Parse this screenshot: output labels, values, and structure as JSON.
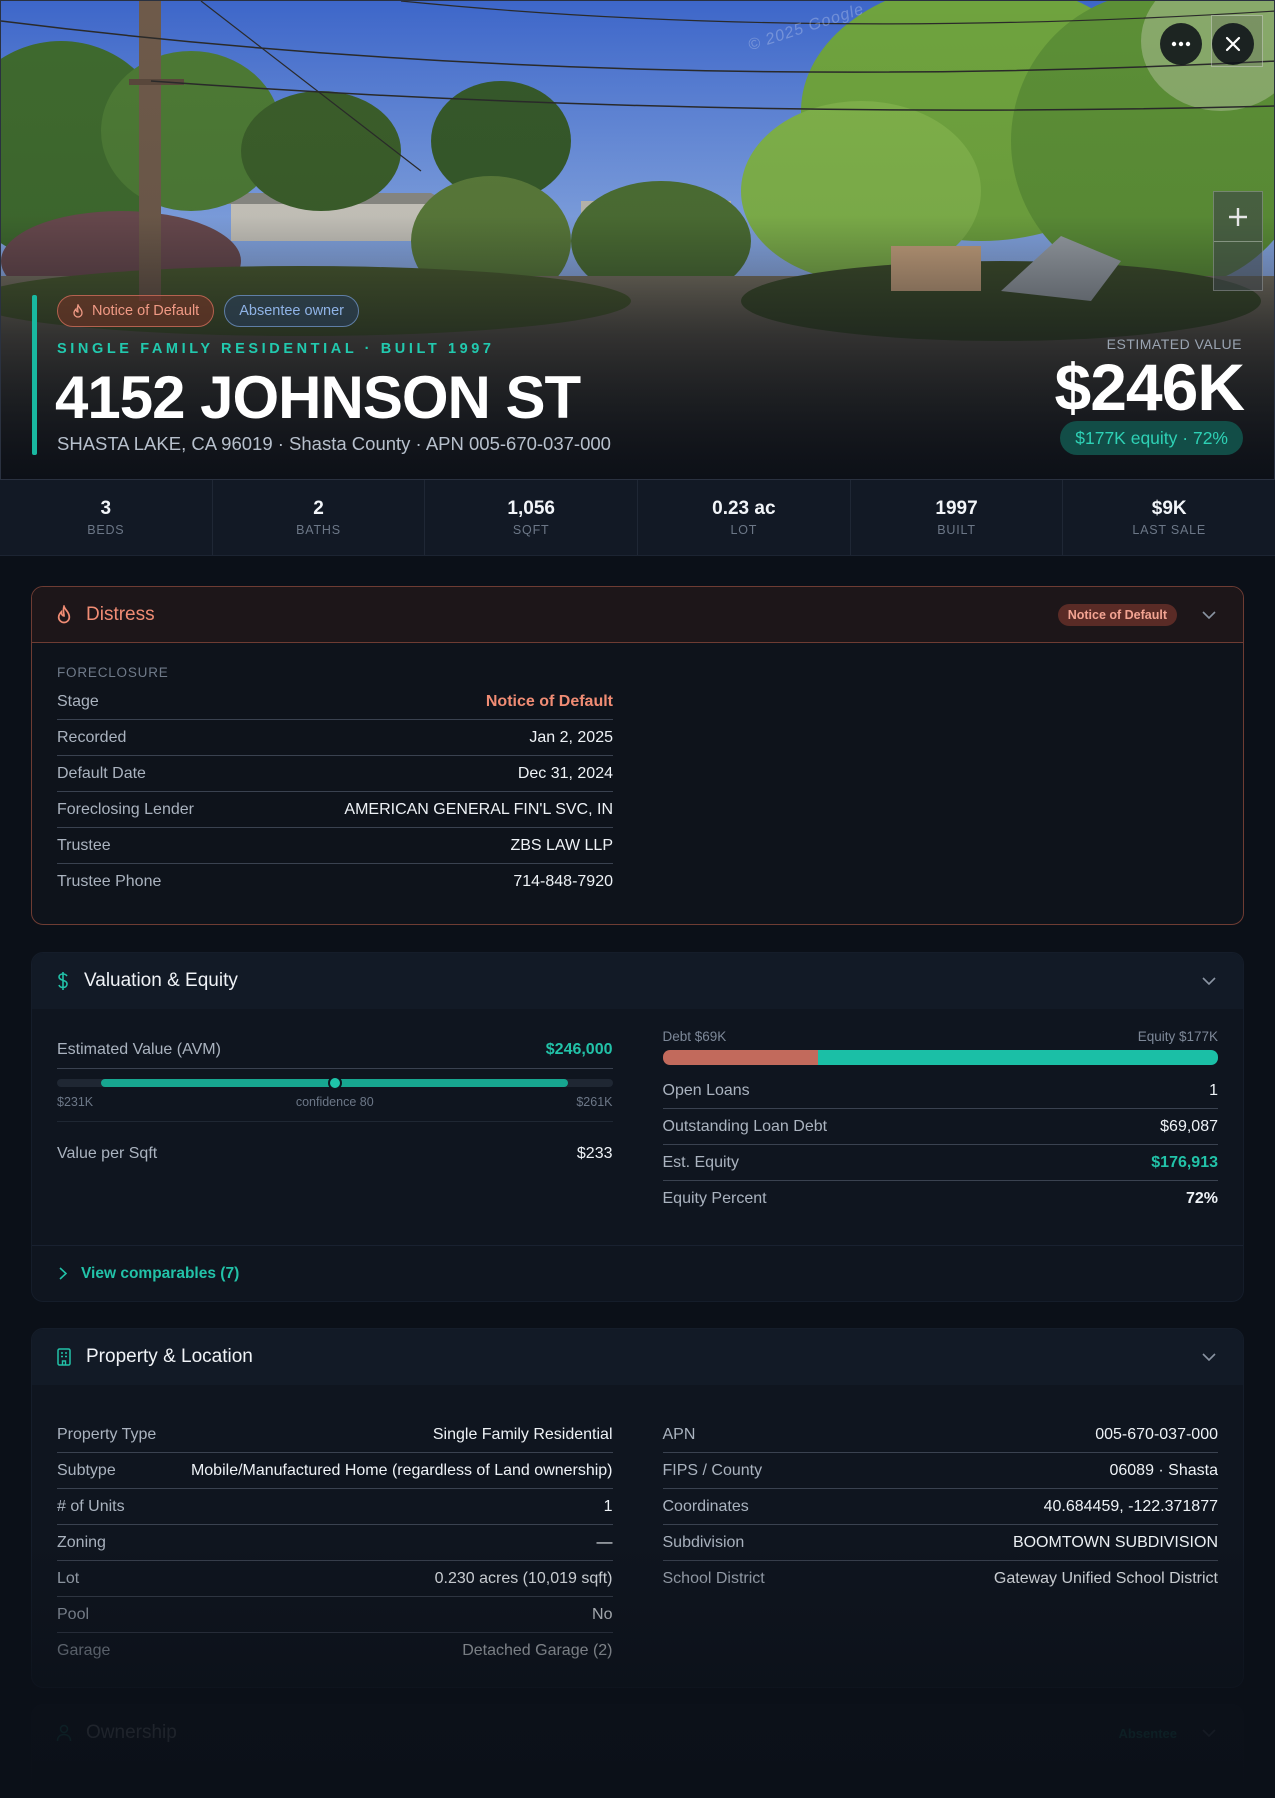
{
  "hero": {
    "watermark": "© 2025 Google",
    "badges": {
      "distress": "Notice of Default",
      "owner": "Absentee owner"
    },
    "property_type": "SINGLE FAMILY RESIDENTIAL · BUILT 1997",
    "address": "4152 JOHNSON ST",
    "sub_address": "SHASTA LAKE, CA 96019 · Shasta County · APN 005-670-037-000",
    "estimated_label": "ESTIMATED VALUE",
    "estimated_value": "$246K",
    "equity_pill": "$177K equity · 72%"
  },
  "stats": [
    {
      "value": "3",
      "label": "BEDS"
    },
    {
      "value": "2",
      "label": "BATHS"
    },
    {
      "value": "1,056",
      "label": "SQFT"
    },
    {
      "value": "0.23 ac",
      "label": "LOT"
    },
    {
      "value": "1997",
      "label": "BUILT"
    },
    {
      "value": "$9K",
      "label": "LAST SALE"
    }
  ],
  "distress": {
    "title": "Distress",
    "badge": "Notice of Default",
    "section": "FORECLOSURE",
    "rows": [
      {
        "k": "Stage",
        "v": "Notice of Default"
      },
      {
        "k": "Recorded",
        "v": "Jan 2, 2025"
      },
      {
        "k": "Default Date",
        "v": "Dec 31, 2024"
      },
      {
        "k": "Foreclosing Lender",
        "v": "AMERICAN GENERAL FIN'L SVC, IN"
      },
      {
        "k": "Trustee",
        "v": "ZBS LAW LLP"
      },
      {
        "k": "Trustee Phone",
        "v": "714-848-7920"
      }
    ]
  },
  "valuation": {
    "title": "Valuation & Equity",
    "avm_label": "Estimated Value (AVM)",
    "avm_value": "$246,000",
    "range_low": "$231K",
    "range_high": "$261K",
    "confidence": "confidence 80",
    "confidence_fraction": 0.5,
    "value_per_sqft_label": "Value per Sqft",
    "value_per_sqft": "$233",
    "debt_label": "Debt $69K",
    "equity_label": "Equity $177K",
    "debt_fraction": 0.28,
    "rows": [
      {
        "k": "Open Loans",
        "v": "1"
      },
      {
        "k": "Outstanding Loan Debt",
        "v": "$69,087"
      },
      {
        "k": "Est. Equity",
        "v": "$176,913"
      },
      {
        "k": "Equity Percent",
        "v": "72%"
      }
    ],
    "comps_label": "View comparables (7)"
  },
  "property": {
    "title": "Property & Location",
    "left": [
      {
        "k": "Property Type",
        "v": "Single Family Residential"
      },
      {
        "k": "Subtype",
        "v": "Mobile/Manufactured Home (regardless of Land ownership)"
      },
      {
        "k": "# of Units",
        "v": "1"
      },
      {
        "k": "Zoning",
        "v": "—"
      },
      {
        "k": "Lot",
        "v": "0.230 acres (10,019 sqft)"
      },
      {
        "k": "Pool",
        "v": "No"
      },
      {
        "k": "Garage",
        "v": "Detached Garage (2)"
      }
    ],
    "right": [
      {
        "k": "APN",
        "v": "005-670-037-000"
      },
      {
        "k": "FIPS / County",
        "v": "06089 · Shasta"
      },
      {
        "k": "Coordinates",
        "v": "40.684459, -122.371877"
      },
      {
        "k": "Subdivision",
        "v": "BOOMTOWN SUBDIVISION"
      },
      {
        "k": "School District",
        "v": "Gateway Unified School District"
      }
    ]
  },
  "ownership": {
    "title": "Ownership",
    "badge": "Absentee"
  },
  "colors": {
    "accent": "#19b8a0",
    "distress": "#f08c74",
    "debt": "#c26a5c",
    "equity": "#1bbfa6"
  },
  "icons": [
    "more-icon",
    "close-icon",
    "plus-icon",
    "flame-icon",
    "dollar-icon",
    "building-icon",
    "chevron-down-icon",
    "chevron-right-icon",
    "user-icon"
  ]
}
